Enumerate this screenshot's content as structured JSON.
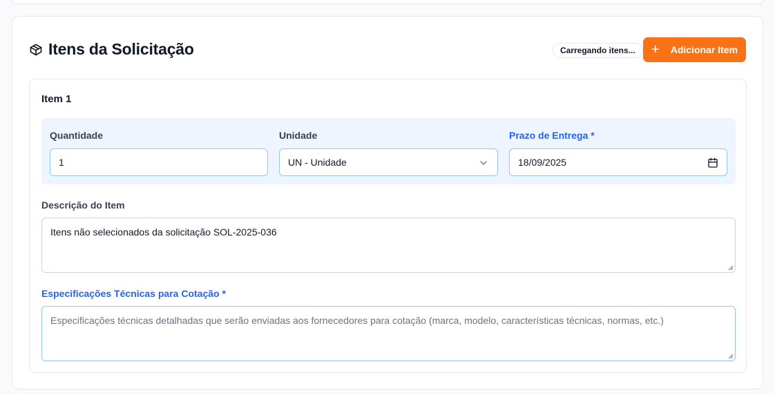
{
  "section": {
    "title": "Itens da Solicitação",
    "loading_badge": "Carregando itens...",
    "add_button_label": "Adicionar Item"
  },
  "item": {
    "title": "Item 1",
    "quantity": {
      "label": "Quantidade",
      "value": "1"
    },
    "unit": {
      "label": "Unidade",
      "value": "UN - Unidade"
    },
    "deadline": {
      "label": "Prazo de Entrega *",
      "value": "18/09/2025"
    },
    "description": {
      "label": "Descrição do Item",
      "value": "Itens não selecionados da solicitação SOL-2025-036"
    },
    "specs": {
      "label": "Especificações Técnicas para Cotação *",
      "placeholder": "Especificações técnicas detalhadas que serão enviadas aos fornecedores para cotação (marca, modelo, características técnicas, normas, etc.)"
    }
  },
  "colors": {
    "accent": "#f97316",
    "required_label": "#2563eb",
    "panel_bg": "#eef5fe"
  },
  "icons": {
    "section": "package-icon",
    "add": "plus-icon",
    "select": "chevron-down-icon",
    "date": "calendar-icon"
  }
}
